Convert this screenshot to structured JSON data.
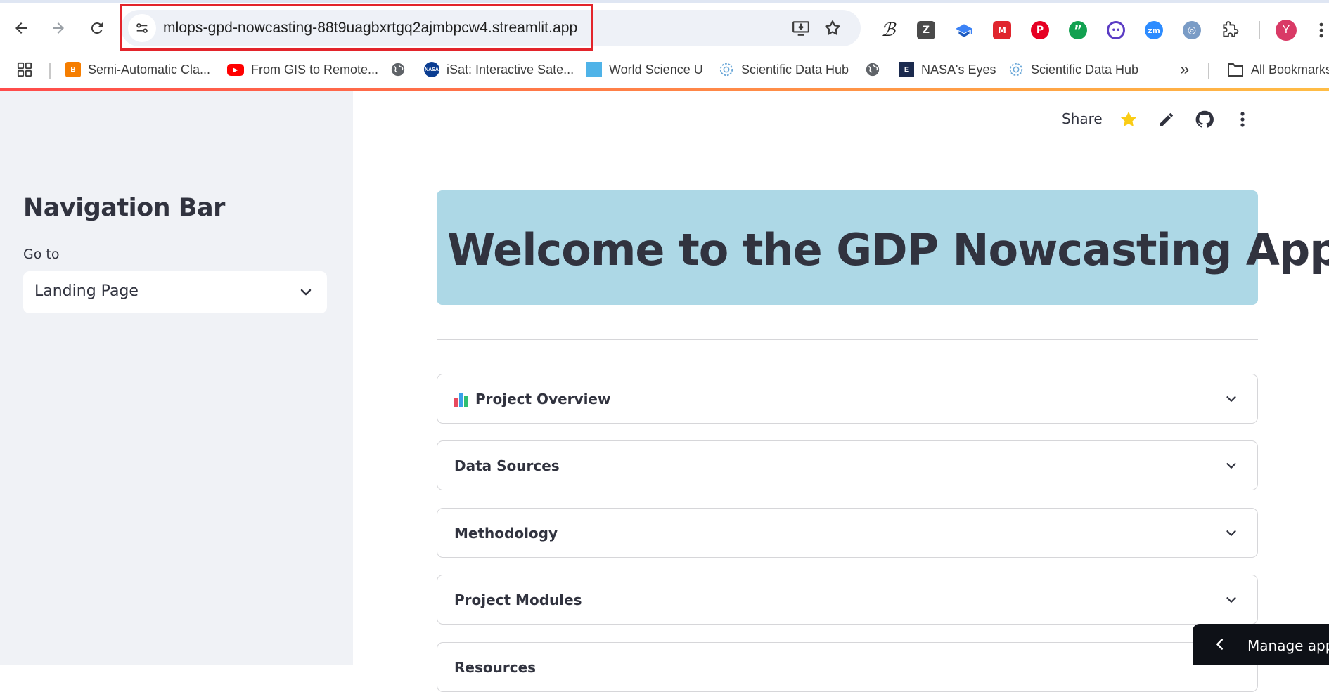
{
  "browser": {
    "url": "mlops-gpd-nowcasting-88t9uagbxrtgq2ajmbpcw4.streamlit.app",
    "profile_initial": "Y",
    "extensions": [
      {
        "name": "bold-b-extension-icon",
        "glyph": "ℬ",
        "color": "#1f1f1f"
      },
      {
        "name": "zotero-icon",
        "glyph": "Z",
        "color": "#4a4a4a"
      },
      {
        "name": "graduation-cap-icon",
        "glyph": "▲",
        "color": "#3b82f6"
      },
      {
        "name": "mendeley-icon",
        "glyph": "M",
        "color": "#e0262e"
      },
      {
        "name": "pinterest-icon",
        "glyph": "P",
        "color": "#e60023"
      },
      {
        "name": "quote-icon",
        "glyph": "”",
        "color": "#12a150"
      },
      {
        "name": "face-extension-icon",
        "glyph": "••",
        "color": "#5b3cc4"
      },
      {
        "name": "zoom-icon",
        "glyph": "zm",
        "color": "#2d8cff"
      },
      {
        "name": "swirl-extension-icon",
        "glyph": "◎",
        "color": "#7a9cc6"
      }
    ]
  },
  "bookmarks": [
    {
      "label": "Semi-Automatic Cla...",
      "icon": "blogger-icon",
      "color": "#f57d00",
      "glyph": "B"
    },
    {
      "label": "From GIS to Remote...",
      "icon": "youtube-icon",
      "color": "#ff0000",
      "glyph": "▶"
    },
    {
      "label": "",
      "icon": "globe-icon",
      "color": "#5f6368",
      "glyph": "◍"
    },
    {
      "label": "iSat: Interactive Sate...",
      "icon": "nasa-icon",
      "color": "#0b3d91",
      "glyph": "N"
    },
    {
      "label": "World Science U",
      "icon": "world-science-u-icon",
      "color": "#4fb3e8",
      "glyph": "W"
    },
    {
      "label": "Scientific Data Hub",
      "icon": "data-hub-icon",
      "color": "#6aa7d8",
      "glyph": "⚙"
    },
    {
      "label": "",
      "icon": "globe-icon",
      "color": "#5f6368",
      "glyph": "◍"
    },
    {
      "label": "NASA's Eyes",
      "icon": "nasa-eyes-icon",
      "color": "#1b2a4e",
      "glyph": "E"
    },
    {
      "label": "Scientific Data Hub",
      "icon": "data-hub-icon",
      "color": "#6aa7d8",
      "glyph": "⚙"
    }
  ],
  "bookmarks_overflow": "»",
  "all_bookmarks": "All Bookmarks",
  "sidebar": {
    "title": "Navigation Bar",
    "select_label": "Go to",
    "select_value": "Landing Page"
  },
  "header": {
    "share": "Share"
  },
  "hero": {
    "title": "Welcome to the GDP Nowcasting App",
    "bg_color": "#add8e6"
  },
  "expanders": [
    {
      "label": "Project Overview",
      "emoji": "bar-chart-icon"
    },
    {
      "label": "Data Sources"
    },
    {
      "label": "Methodology"
    },
    {
      "label": "Project Modules"
    },
    {
      "label": "Resources"
    }
  ],
  "manage_app": "Manage app"
}
